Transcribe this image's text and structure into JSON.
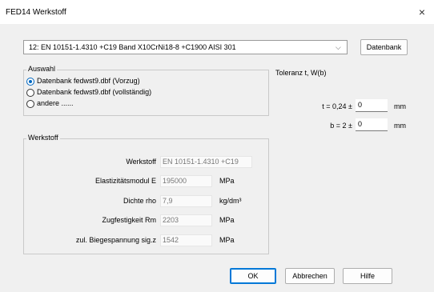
{
  "window": {
    "title": "FED14 Werkstoff",
    "close_glyph": "×"
  },
  "material_combo": {
    "value": "12: EN 10151-1.4310 +C19 Band X10CrNi18-8 +C1900      AISI 301",
    "arrow": "⌵"
  },
  "buttons": {
    "datenbank": "Datenbank",
    "ok": "OK",
    "abbrechen": "Abbrechen",
    "hilfe": "Hilfe"
  },
  "auswahl": {
    "legend": "Auswahl",
    "options": [
      {
        "label": "Datenbank fedwst9.dbf (Vorzug)",
        "checked": true
      },
      {
        "label": "Datenbank fedwst9.dbf (vollständig)",
        "checked": false
      },
      {
        "label": "andere ......",
        "checked": false
      }
    ]
  },
  "toleranz": {
    "heading": "Toleranz t, W(b)",
    "t_label": "t = 0,24 ±",
    "t_value": "0",
    "t_unit": "mm",
    "b_label": "b = 2 ±",
    "b_value": "0",
    "b_unit": "mm"
  },
  "werkstoff": {
    "legend": "Werkstoff",
    "rows": [
      {
        "label": "Werkstoff",
        "value": "EN 10151-1.4310 +C19",
        "unit": ""
      },
      {
        "label": "Elastizitätsmodul E",
        "value": "195000",
        "unit": "MPa"
      },
      {
        "label": "Dichte rho",
        "value": "7,9",
        "unit": "kg/dm³"
      },
      {
        "label": "Zugfestigkeit Rm",
        "value": "2203",
        "unit": "MPa"
      },
      {
        "label": "zul. Biegespannung sig.z",
        "value": "1542",
        "unit": "MPa"
      }
    ]
  }
}
